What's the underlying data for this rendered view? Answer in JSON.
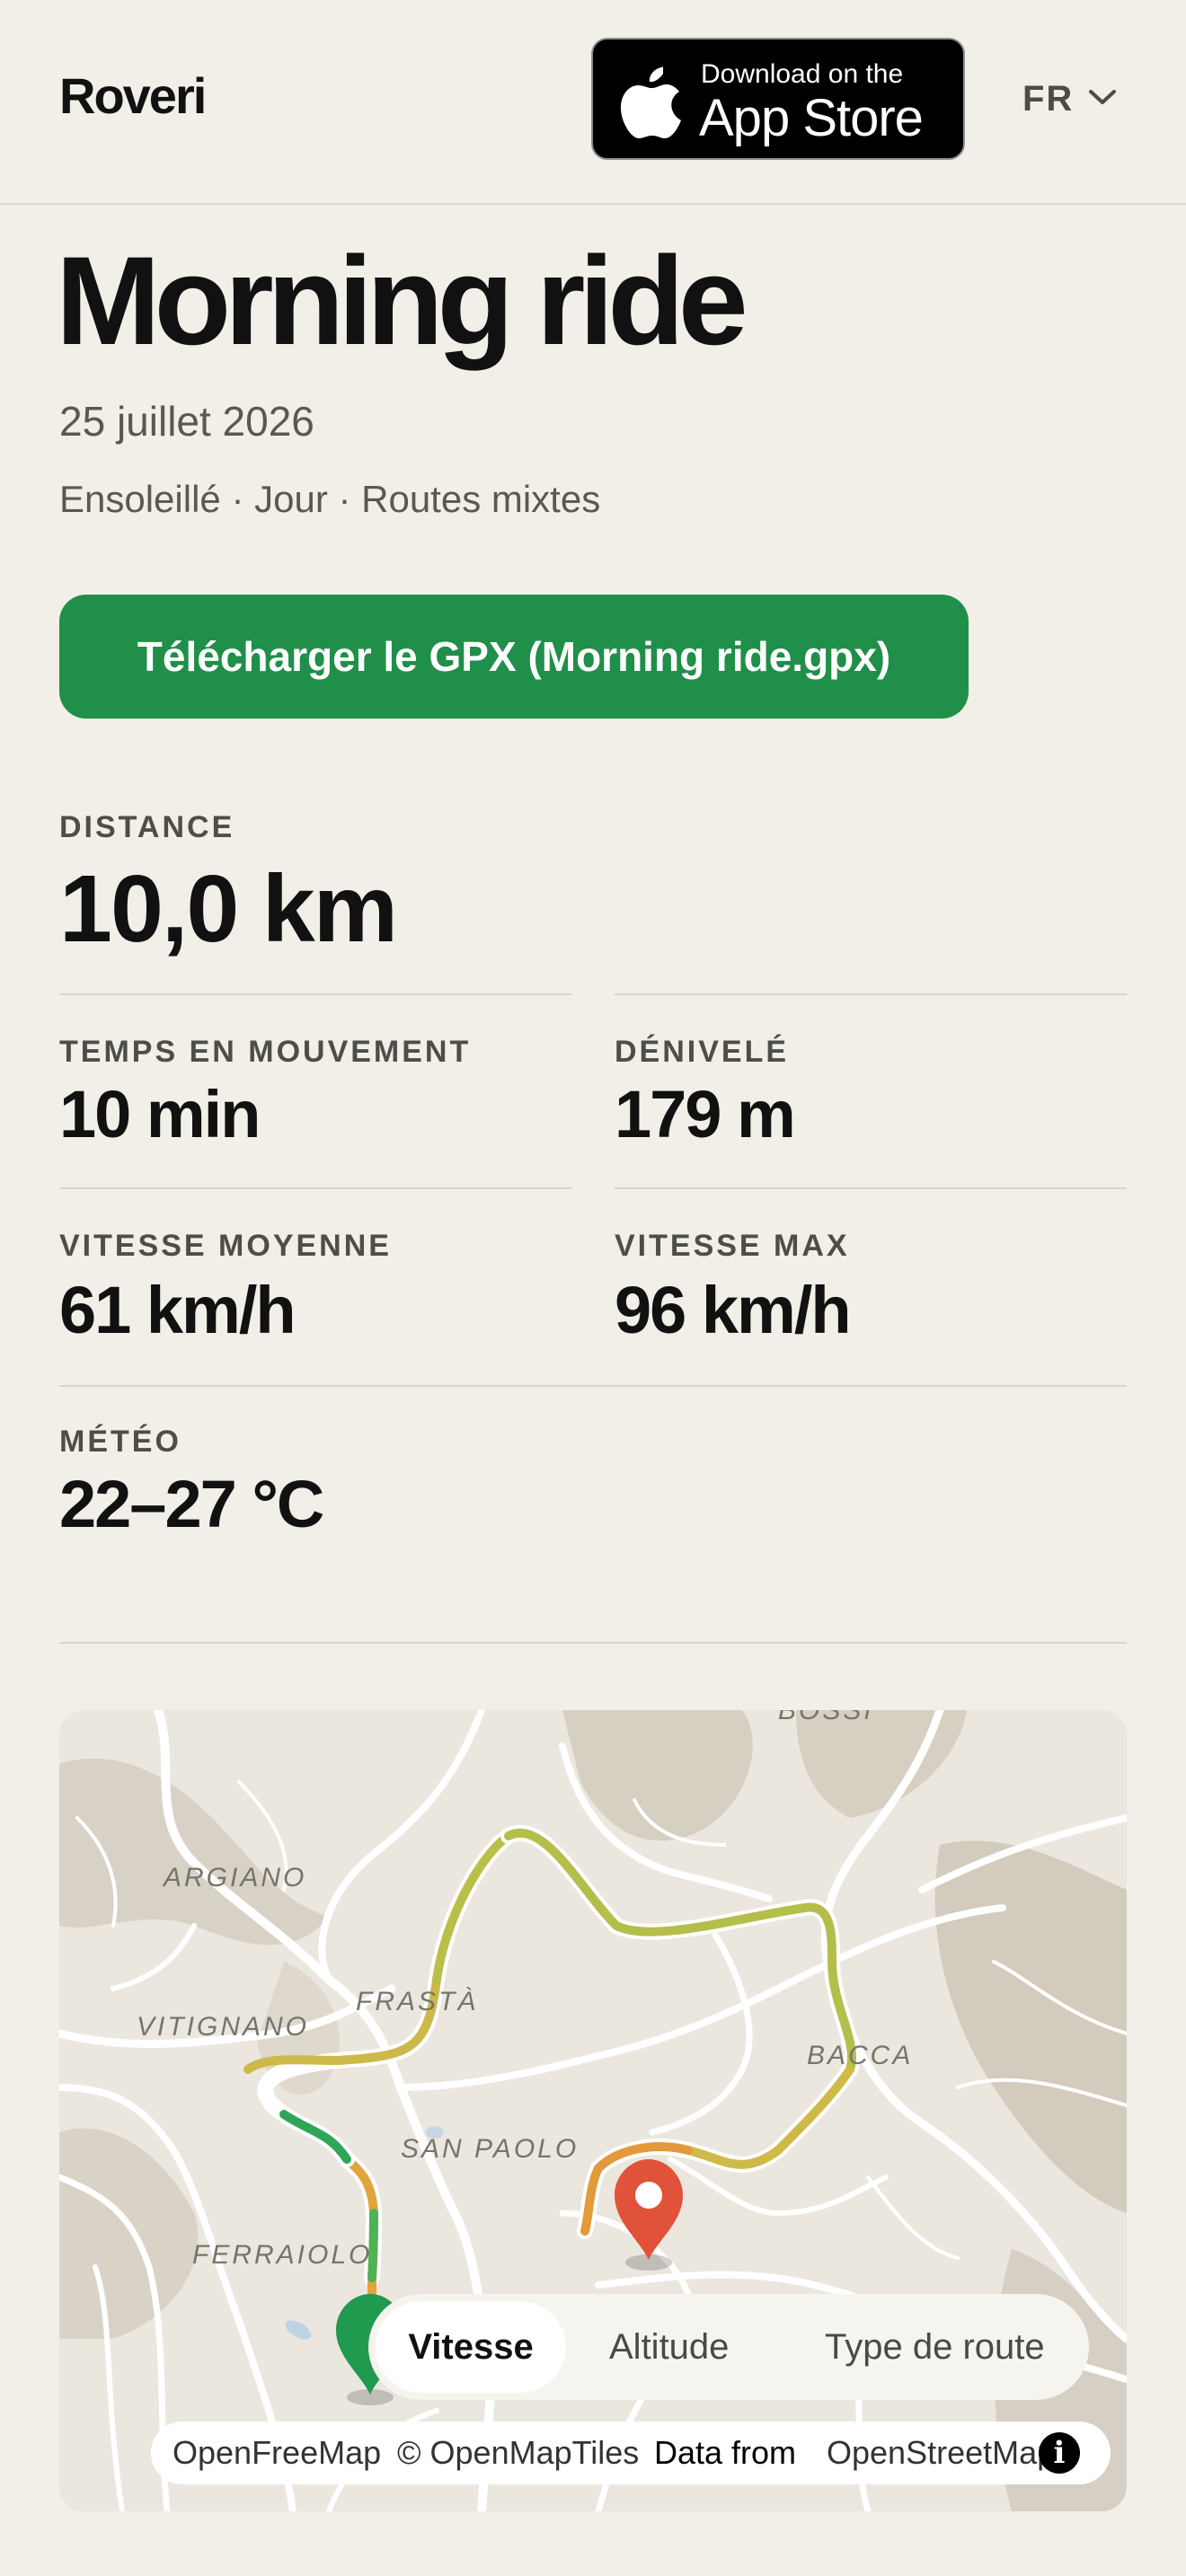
{
  "header": {
    "brand": "Roveri",
    "app_store_small": "Download on the",
    "app_store_big": "App Store",
    "language": "FR"
  },
  "ride": {
    "title": "Morning ride",
    "date": "25 juillet 2026",
    "conditions": "Ensoleillé · Jour · Routes mixtes",
    "gpx_button": "Télécharger le GPX (Morning ride.gpx)"
  },
  "stats": {
    "distance_label": "DISTANCE",
    "distance_value": "10,0 km",
    "moving_time_label": "TEMPS EN MOUVEMENT",
    "moving_time_value": "10 min",
    "elevation_label": "DÉNIVELÉ",
    "elevation_value": "179 m",
    "avg_speed_label": "VITESSE MOYENNE",
    "avg_speed_value": "61 km/h",
    "max_speed_label": "VITESSE MAX",
    "max_speed_value": "96 km/h",
    "weather_label": "MÉTÉO",
    "weather_value": "22–27 °C"
  },
  "map": {
    "places": [
      "BOSSI",
      "ARGIANO",
      "FRASTÀ",
      "VITIGNANO",
      "BACCA",
      "SAN PAOLO",
      "FERRAIOLO"
    ],
    "tabs": [
      "Vitesse",
      "Altitude",
      "Type de route"
    ],
    "active_tab": "Vitesse",
    "attribution_1": "OpenFreeMap",
    "attribution_2": "© OpenMapTiles",
    "attribution_3": "Data from",
    "attribution_4": "OpenStreetMap",
    "info_glyph": "i",
    "colors": {
      "start_pin": "#1f9a4e",
      "end_pin": "#e0533a",
      "slow": "#22a35a",
      "medium": "#c7c043",
      "fast": "#e08a3a"
    }
  }
}
